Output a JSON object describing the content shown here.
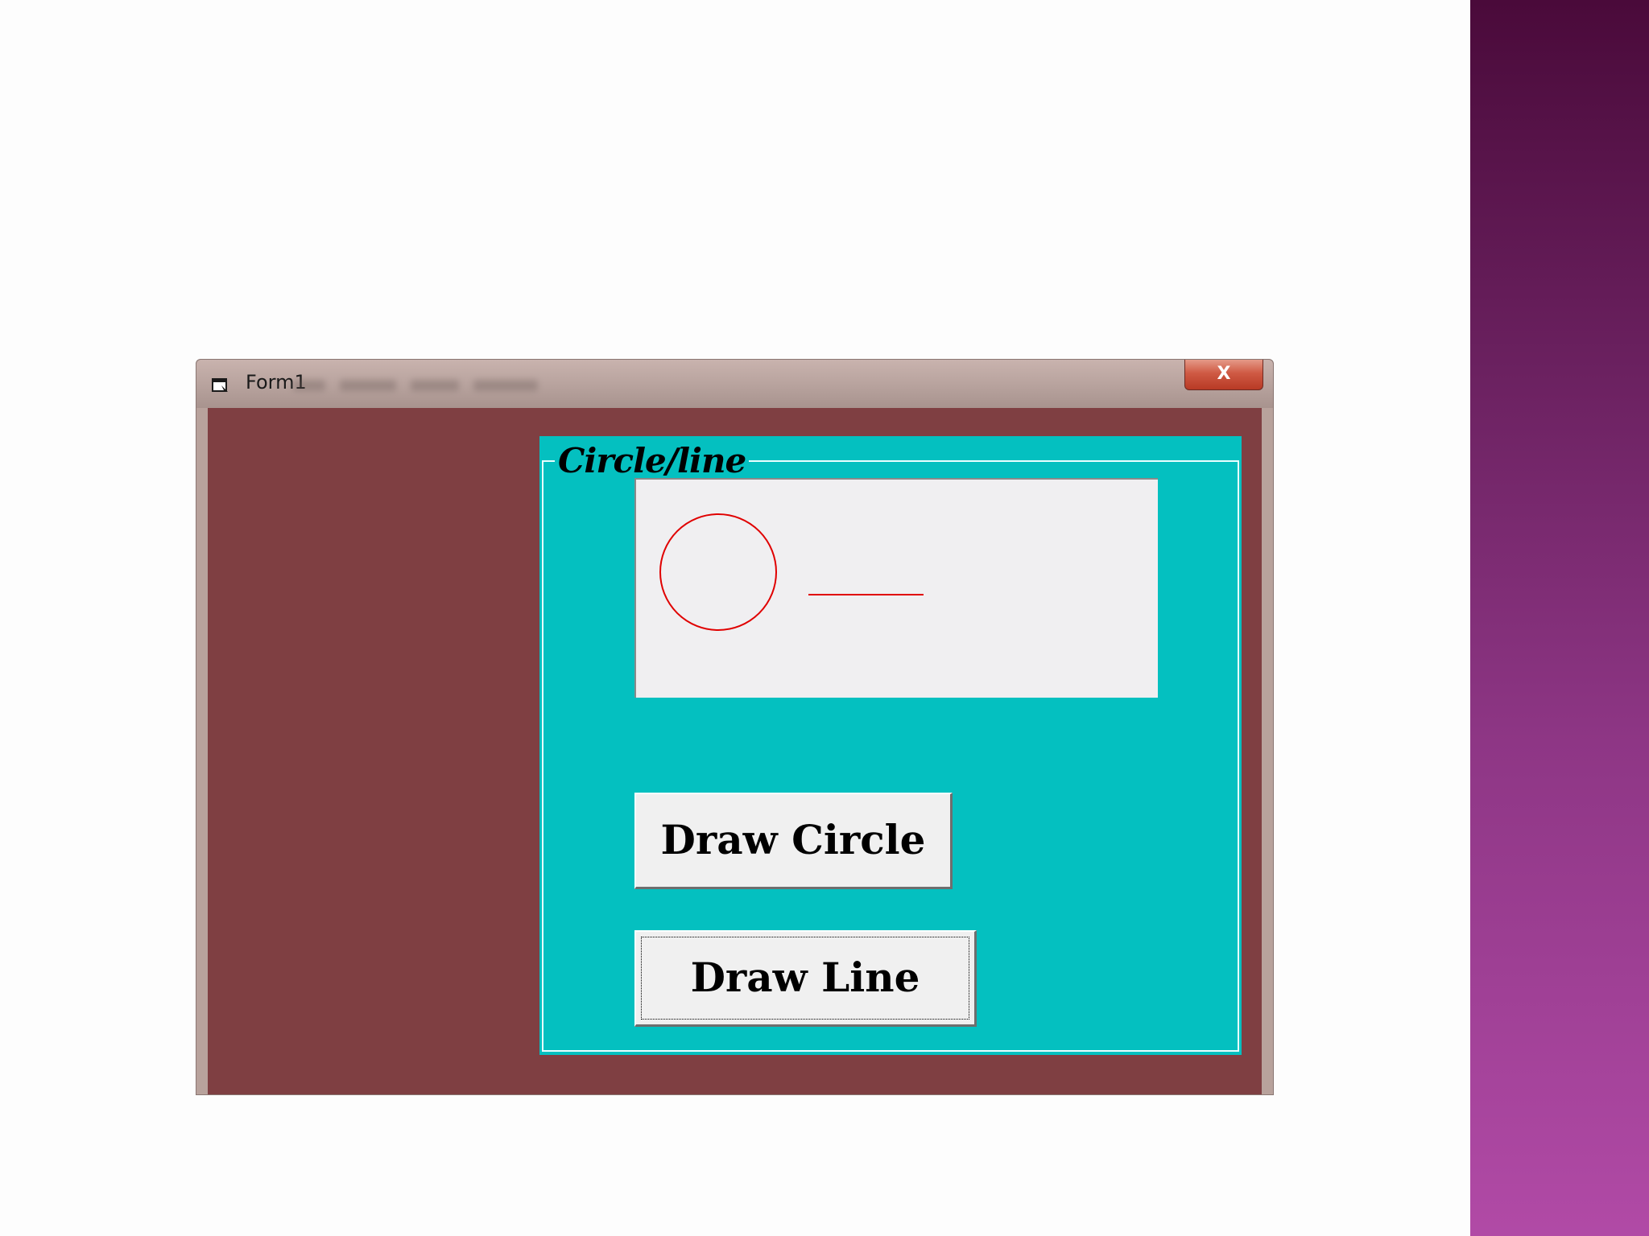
{
  "window": {
    "title": "Form1",
    "close_label": "X",
    "client_color": "#7f3f42"
  },
  "frame": {
    "caption": "Circle/line",
    "background": "#04c0c0"
  },
  "picture": {
    "background": "#f0eff1",
    "stroke_color": "#e00000"
  },
  "buttons": {
    "draw_circle": "Draw Circle",
    "draw_line": "Draw Line"
  },
  "icons": {
    "title": "form-window-icon",
    "close": "close-icon"
  }
}
